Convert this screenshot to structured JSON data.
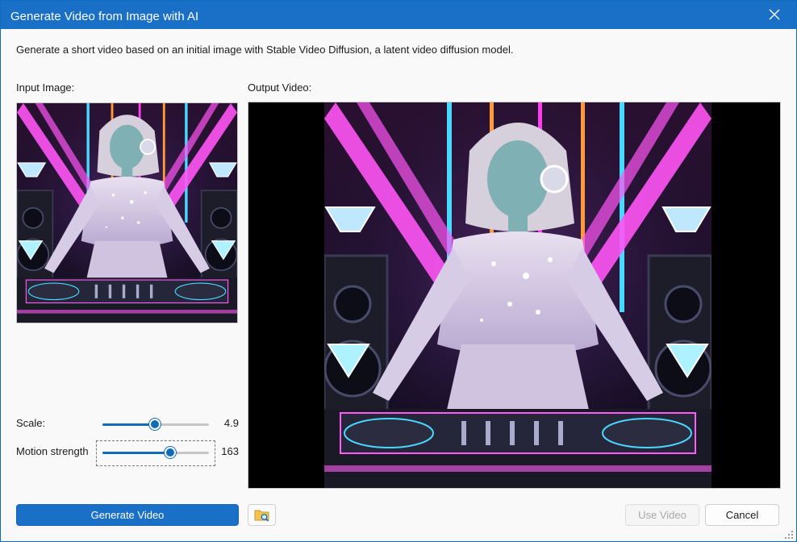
{
  "window": {
    "title": "Generate Video from Image with AI"
  },
  "description": "Generate a short video based on an initial image with Stable Video Diffusion, a latent video diffusion model.",
  "input": {
    "label": "Input Image:"
  },
  "output": {
    "label": "Output Video:"
  },
  "controls": {
    "scale": {
      "label": "Scale:",
      "value": "4.9",
      "fraction": 0.49
    },
    "motion": {
      "label": "Motion strength",
      "value": "163",
      "fraction": 0.64
    }
  },
  "buttons": {
    "generate": "Generate Video",
    "use_video": "Use Video",
    "cancel": "Cancel"
  },
  "icons": {
    "close": "close-icon",
    "folder": "folder-search-icon",
    "grip": "resize-grip-icon"
  },
  "colors": {
    "accent": "#1a6fc7",
    "neon_pink": "#ff3cf0",
    "neon_cyan": "#4ad8ff",
    "neon_orange": "#ff9a3c"
  }
}
